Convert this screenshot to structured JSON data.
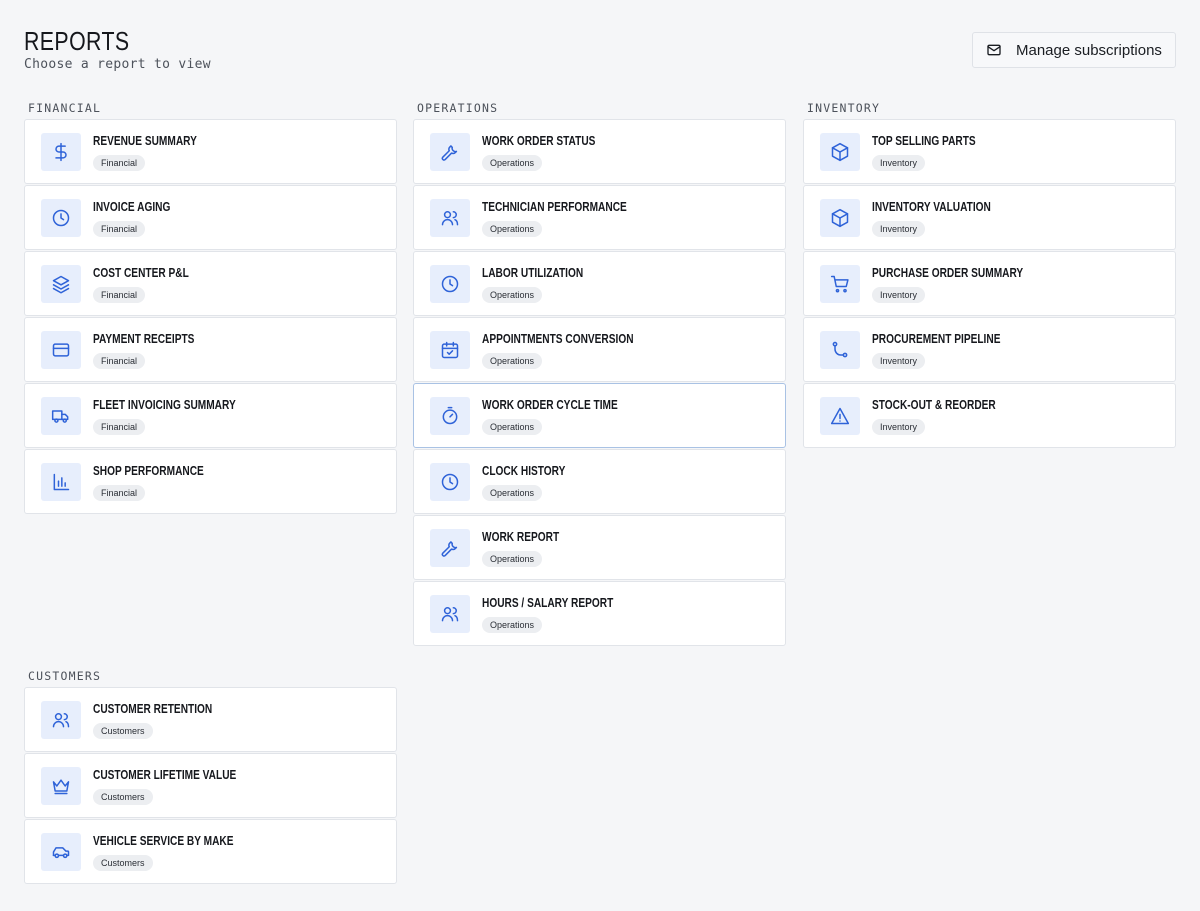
{
  "header": {
    "title": "REPORTS",
    "subtitle": "Choose a report to view",
    "manage_label": "Manage subscriptions"
  },
  "sections": {
    "financial": {
      "title": "FINANCIAL",
      "cards": [
        {
          "title": "REVENUE SUMMARY",
          "tag": "Financial",
          "icon": "dollar-icon"
        },
        {
          "title": "INVOICE AGING",
          "tag": "Financial",
          "icon": "clock-icon"
        },
        {
          "title": "COST CENTER P&L",
          "tag": "Financial",
          "icon": "layers-icon"
        },
        {
          "title": "PAYMENT RECEIPTS",
          "tag": "Financial",
          "icon": "credit-card-icon"
        },
        {
          "title": "FLEET INVOICING SUMMARY",
          "tag": "Financial",
          "icon": "truck-icon"
        },
        {
          "title": "SHOP PERFORMANCE",
          "tag": "Financial",
          "icon": "bar-chart-icon"
        }
      ]
    },
    "operations": {
      "title": "OPERATIONS",
      "cards": [
        {
          "title": "WORK ORDER STATUS",
          "tag": "Operations",
          "icon": "wrench-icon"
        },
        {
          "title": "TECHNICIAN PERFORMANCE",
          "tag": "Operations",
          "icon": "users-icon"
        },
        {
          "title": "LABOR UTILIZATION",
          "tag": "Operations",
          "icon": "clock-icon"
        },
        {
          "title": "APPOINTMENTS CONVERSION",
          "tag": "Operations",
          "icon": "calendar-check-icon"
        },
        {
          "title": "WORK ORDER CYCLE TIME",
          "tag": "Operations",
          "icon": "timer-icon"
        },
        {
          "title": "CLOCK HISTORY",
          "tag": "Operations",
          "icon": "clock-icon"
        },
        {
          "title": "WORK REPORT",
          "tag": "Operations",
          "icon": "wrench-icon"
        },
        {
          "title": "HOURS / SALARY REPORT",
          "tag": "Operations",
          "icon": "users-icon"
        }
      ]
    },
    "inventory": {
      "title": "INVENTORY",
      "cards": [
        {
          "title": "TOP SELLING PARTS",
          "tag": "Inventory",
          "icon": "box-icon"
        },
        {
          "title": "INVENTORY VALUATION",
          "tag": "Inventory",
          "icon": "box-icon"
        },
        {
          "title": "PURCHASE ORDER SUMMARY",
          "tag": "Inventory",
          "icon": "cart-icon"
        },
        {
          "title": "PROCUREMENT PIPELINE",
          "tag": "Inventory",
          "icon": "pipeline-icon"
        },
        {
          "title": "STOCK-OUT & REORDER",
          "tag": "Inventory",
          "icon": "alert-triangle-icon"
        }
      ]
    },
    "customers": {
      "title": "CUSTOMERS",
      "cards": [
        {
          "title": "CUSTOMER RETENTION",
          "tag": "Customers",
          "icon": "users-icon"
        },
        {
          "title": "CUSTOMER LIFETIME VALUE",
          "tag": "Customers",
          "icon": "crown-icon"
        },
        {
          "title": "VEHICLE SERVICE BY MAKE",
          "tag": "Customers",
          "icon": "car-icon"
        }
      ]
    }
  },
  "colors": {
    "accent": "#2f63d8",
    "icon_bg": "#e7eefc",
    "active_border": "#a9c2e4"
  }
}
